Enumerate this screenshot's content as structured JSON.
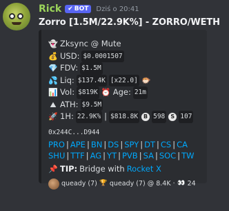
{
  "author": {
    "name": "Rick",
    "badge": "BOT",
    "timestamp": "Dziś o 20:41"
  },
  "title": "Zorro [1.5M/22.9K%] - ZORRO/WETH",
  "token": {
    "name": "Zksync @ Mute"
  },
  "stats": {
    "usd_label": "USD:",
    "usd_value": "$0.0001507",
    "fdv_label": "FDV:",
    "fdv_value": "$1.5M",
    "liq_label": "Liq:",
    "liq_value": "$137.4K",
    "liq_mult": "[x22.0]",
    "vol_label": "Vol:",
    "vol_value": "$819K",
    "age_label": "Age:",
    "age_value": "21m",
    "ath_label": "ATH:",
    "ath_value": "$9.5M",
    "h1_label": "1H:",
    "h1_pct": "22.9K%",
    "h1_vol": "$818.8K",
    "buys": "598",
    "sells": "107",
    "buy_icon": "B",
    "sell_icon": "S"
  },
  "address": "0x244C...D944",
  "links_row1": [
    "PRO",
    "APE",
    "BN",
    "DS",
    "SPY",
    "DT",
    "CS",
    "CA"
  ],
  "links_row2": [
    "SHU",
    "TTF",
    "AG",
    "YT",
    "PVB",
    "SA",
    "SOC",
    "TW"
  ],
  "tip": {
    "label": "TIP:",
    "text": "Bridge with",
    "link": "Rocket X"
  },
  "footer": {
    "user1": "queady (7)",
    "user2": "queady (7) @ 8.4K",
    "sep": "·",
    "count": "24"
  },
  "icons": {
    "token": "ghost-icon",
    "usd": "money-bag-icon",
    "fdv": "diamond-icon",
    "liq": "water-icon",
    "liq_extra": "fish-icon",
    "vol": "chart-icon",
    "age": "clock-icon",
    "ath": "mountain-icon",
    "h1": "rocket-icon",
    "tip": "pushpin-icon",
    "footer_mid": "trophy-icon",
    "footer_end": "eyes-icon"
  }
}
